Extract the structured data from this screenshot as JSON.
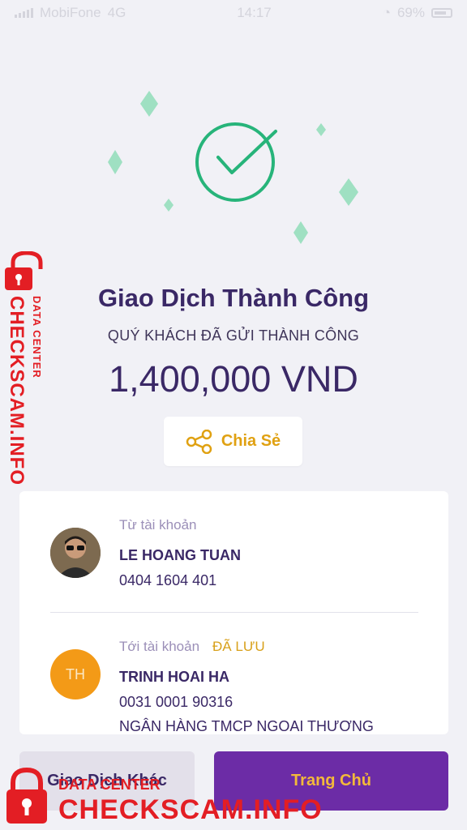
{
  "status_bar": {
    "carrier": "MobiFone",
    "network": "4G",
    "time": "14:17",
    "battery": "69%"
  },
  "result": {
    "title": "Giao Dịch Thành Công",
    "subtitle": "QUÝ KHÁCH ĐÃ GỬI THÀNH CÔNG",
    "amount": "1,400,000 VND",
    "share_label": "Chia Sẻ"
  },
  "transfer": {
    "from_label": "Từ tài khoản",
    "from_name": "LE HOANG TUAN",
    "from_account": "0404 1604 401",
    "to_label": "Tới tài khoản",
    "to_saved_badge": "ĐÃ LƯU",
    "to_initials": "TH",
    "to_name": "TRINH HOAI HA",
    "to_account": "0031 0001 90316",
    "to_bank": "NGÂN HÀNG TMCP NGOAI THƯƠNG"
  },
  "actions": {
    "other_transaction": "Giao Dịch Khác",
    "home": "Trang Chủ"
  },
  "watermark": {
    "brand": "CHECKSCAM.INFO",
    "sub": "DATA CENTER"
  },
  "colors": {
    "success_green": "#27b47a",
    "primary_purple": "#6c2ca6",
    "accent_gold": "#e0a112"
  },
  "icons": [
    "checkmark-icon",
    "share-icon",
    "lock-icon",
    "signal-icon",
    "battery-icon"
  ]
}
